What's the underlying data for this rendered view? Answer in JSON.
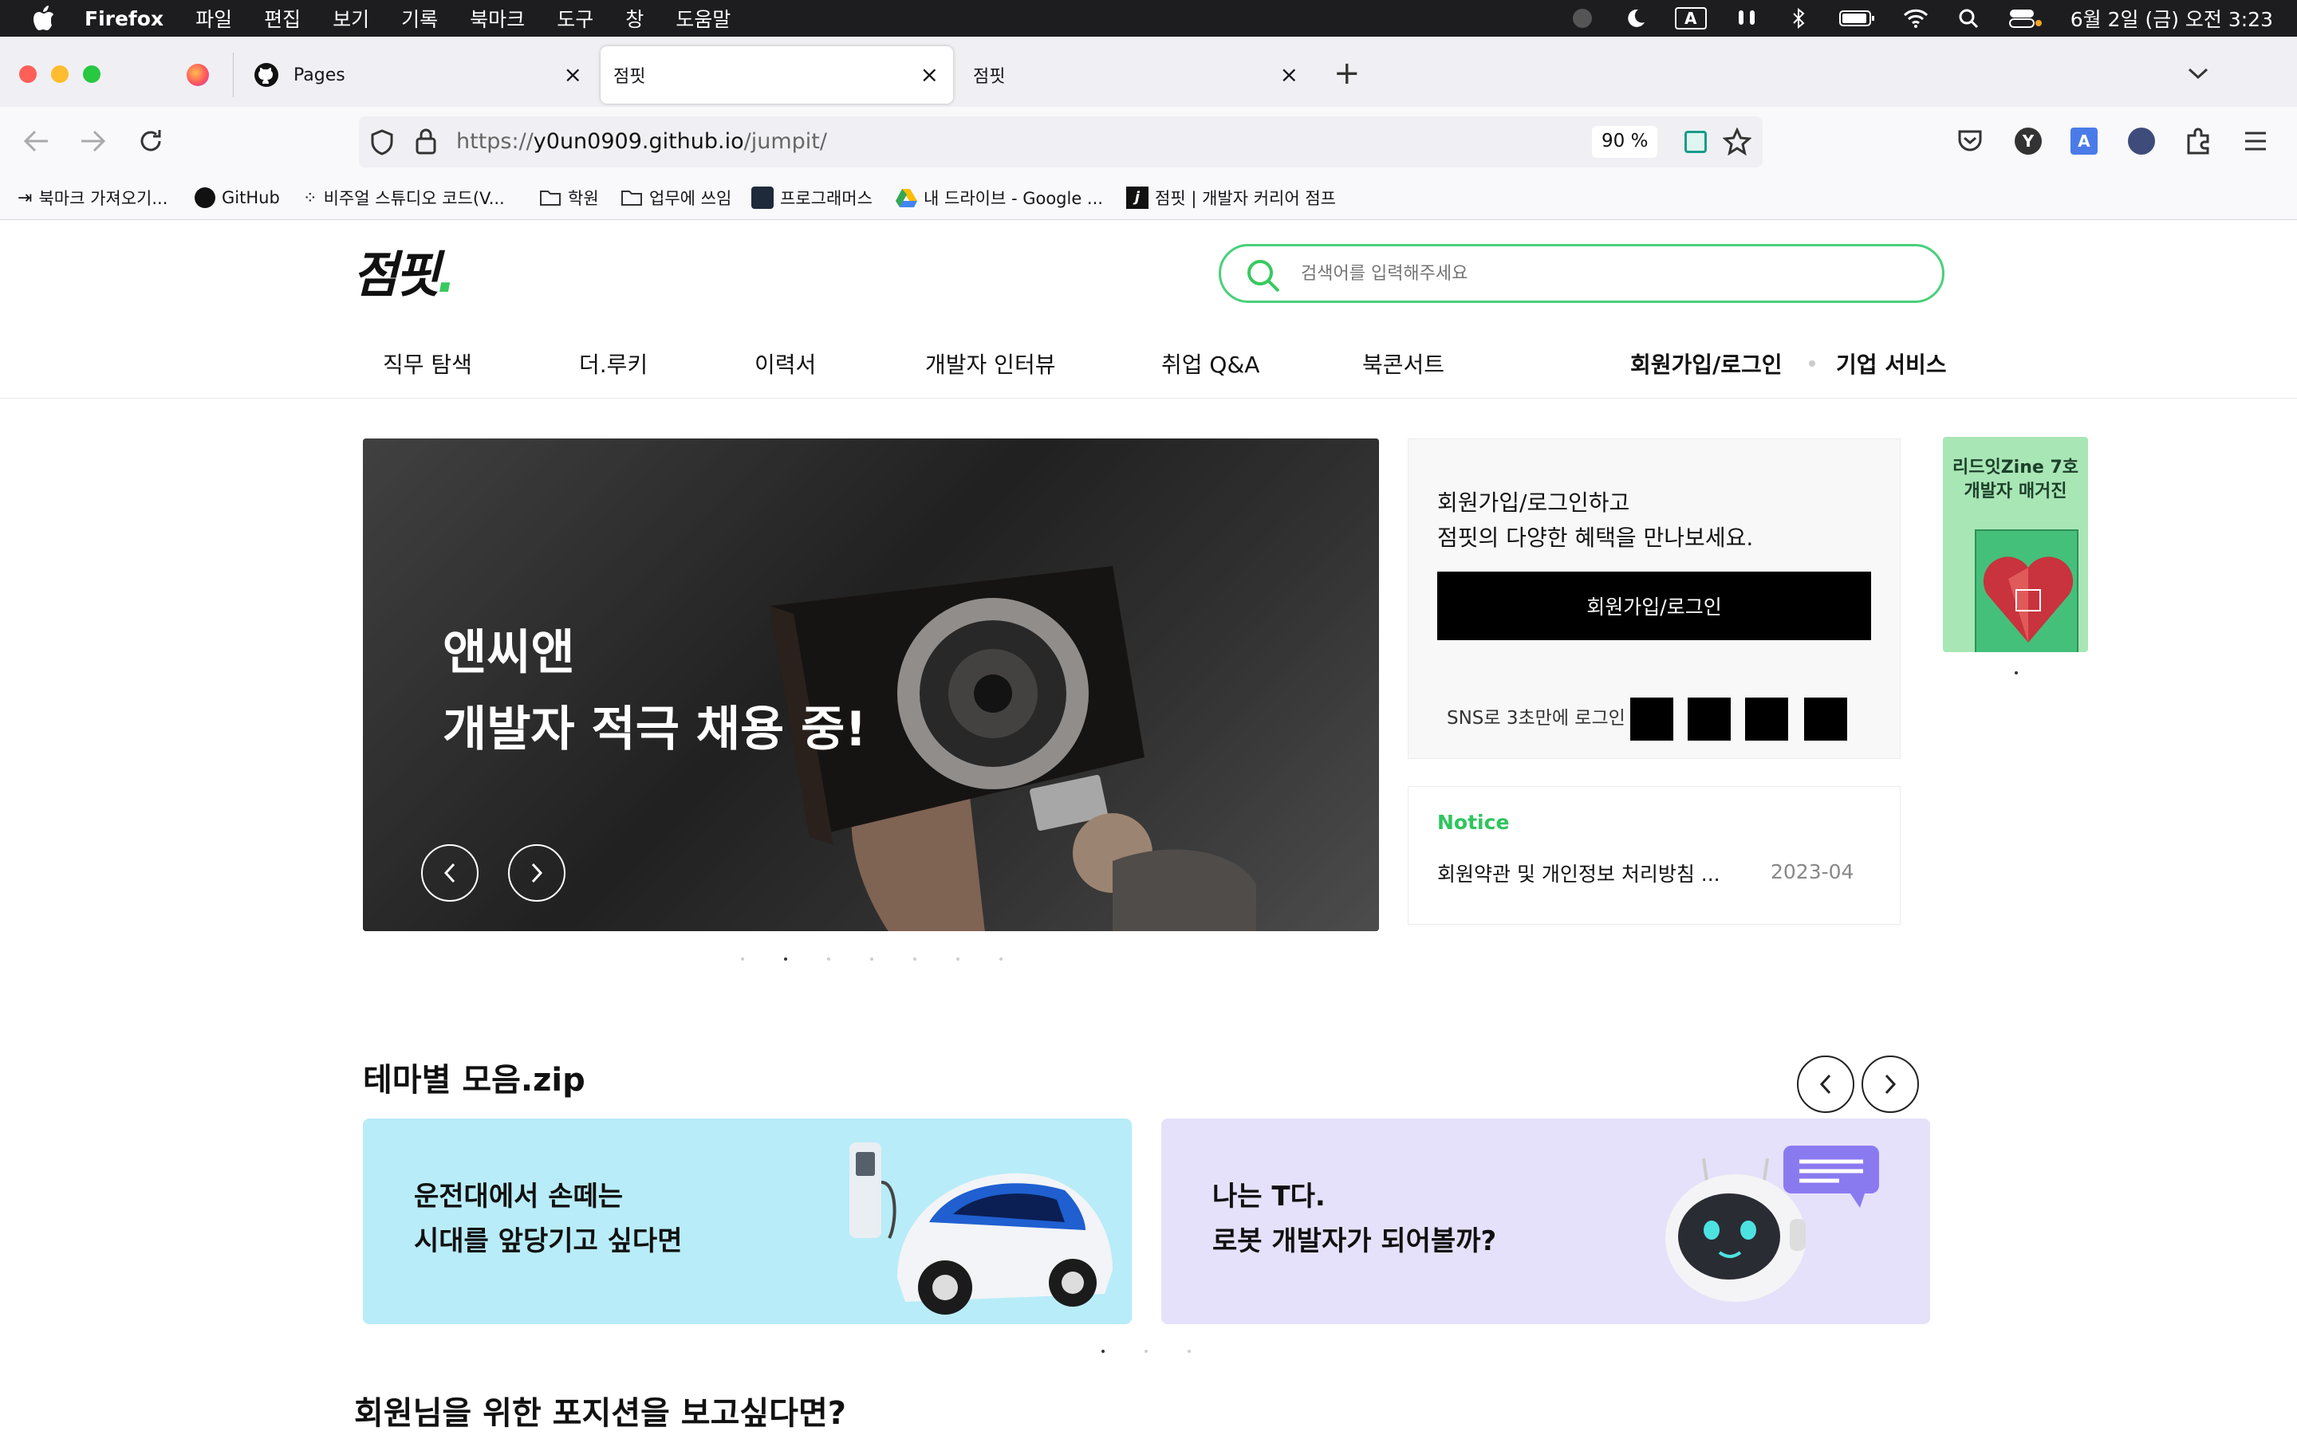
{
  "menubar": {
    "app_name": "Firefox",
    "items": [
      "파일",
      "편집",
      "보기",
      "기록",
      "북마크",
      "도구",
      "창",
      "도움말"
    ],
    "clock": "6월 2일 (금) 오전 3:23",
    "input_indicator": "A"
  },
  "tabs": [
    {
      "label": "Pages"
    },
    {
      "label": "점핏"
    },
    {
      "label": "점핏"
    }
  ],
  "toolbar": {
    "url_prefix": "https://",
    "url_host": "y0un0909.github.io",
    "url_path": "/jumpit/",
    "zoom": "90 %"
  },
  "bookmarks": [
    {
      "label": "북마크 가져오기..."
    },
    {
      "label": "GitHub"
    },
    {
      "label": "비주얼 스튜디오 코드(V..."
    },
    {
      "label": "학원"
    },
    {
      "label": "업무에 쓰임"
    },
    {
      "label": "프로그래머스"
    },
    {
      "label": "내 드라이브 - Google ..."
    },
    {
      "label": "점핏 | 개발자 커리어 점프"
    }
  ],
  "site": {
    "logo": "점핏",
    "search_placeholder": "검색어를 입력해주세요",
    "nav": [
      "직무 탐색",
      "더.루키",
      "이력서",
      "개발자 인터뷰",
      "취업 Q&A",
      "북콘서트"
    ],
    "login_link": "회원가입/로그인",
    "business_link": "기업 서비스",
    "banner_line1": "앤씨앤",
    "banner_line2": "개발자 적극 채용 중!",
    "login_box": {
      "text_line1": "회원가입/로그인하고",
      "text_line2": "점핏의 다양한 혜택을 만나보세요.",
      "button": "회원가입/로그인",
      "sns_label": "SNS로 3초만에 로그인"
    },
    "notice": {
      "title": "Notice",
      "item": "회원약관 및 개인정보 처리방침 ...",
      "date": "2023-04"
    },
    "side_ad": {
      "line1": "리드잇Zine 7호",
      "line2": "개발자 매거진"
    },
    "theme_title": "테마별 모음.zip",
    "theme_cards": [
      {
        "line1": "운전대에서 손떼는",
        "line2": "시대를 앞당기고 싶다면",
        "bg": "#b8ecf8"
      },
      {
        "line1": "나는 T다.",
        "line2": "로봇 개발자가 되어볼까?",
        "bg": "#e6e1fa"
      }
    ],
    "bottom_title": "회원님을 위한 포지션을 보고싶다면?"
  },
  "colors": {
    "accent": "#38c95f",
    "menubar": "#1d1c1e",
    "notice": "#2ec55e"
  }
}
